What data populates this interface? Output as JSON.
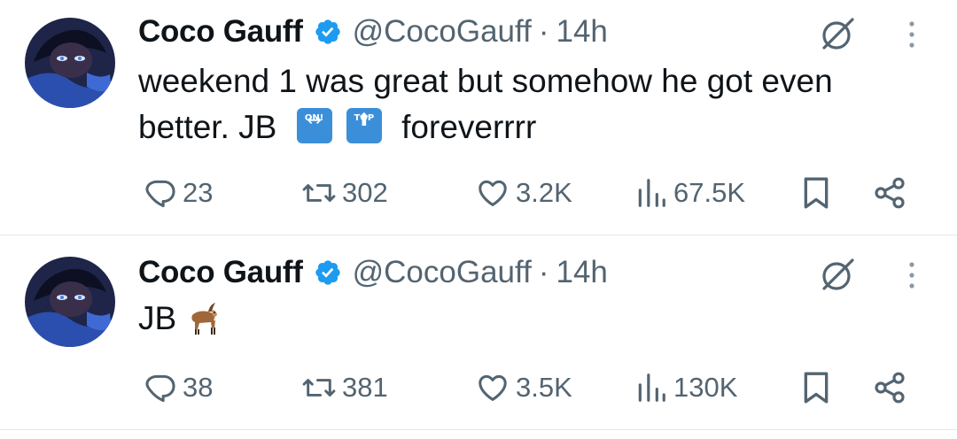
{
  "tweets": [
    {
      "author_name": "Coco Gauff",
      "handle": "@CocoGauff",
      "separator": "·",
      "time": "14h",
      "text_line1": "weekend 1 was great but somehow he got even",
      "text_line2_start": "better. JB",
      "emoji1_label": "ON!",
      "emoji2_label": "TOP",
      "text_line2_end": "foreverrrr",
      "counts": {
        "replies": "23",
        "reposts": "302",
        "likes": "3.2K",
        "views": "67.5K"
      }
    },
    {
      "author_name": "Coco Gauff",
      "handle": "@CocoGauff",
      "separator": "·",
      "time": "14h",
      "text": "JB",
      "counts": {
        "replies": "38",
        "reposts": "381",
        "likes": "3.5K",
        "views": "130K"
      }
    }
  ],
  "icons": {
    "verified": "verified-badge-icon",
    "grok": "grok-icon",
    "more": "more-dots-icon",
    "reply": "reply-icon",
    "repost": "repost-icon",
    "like": "heart-icon",
    "views": "views-icon",
    "bookmark": "bookmark-icon",
    "share": "share-icon"
  },
  "colors": {
    "text": "#0f1419",
    "secondary": "#536471",
    "verified": "#1d9bf0",
    "divider": "#e3e6e8"
  }
}
